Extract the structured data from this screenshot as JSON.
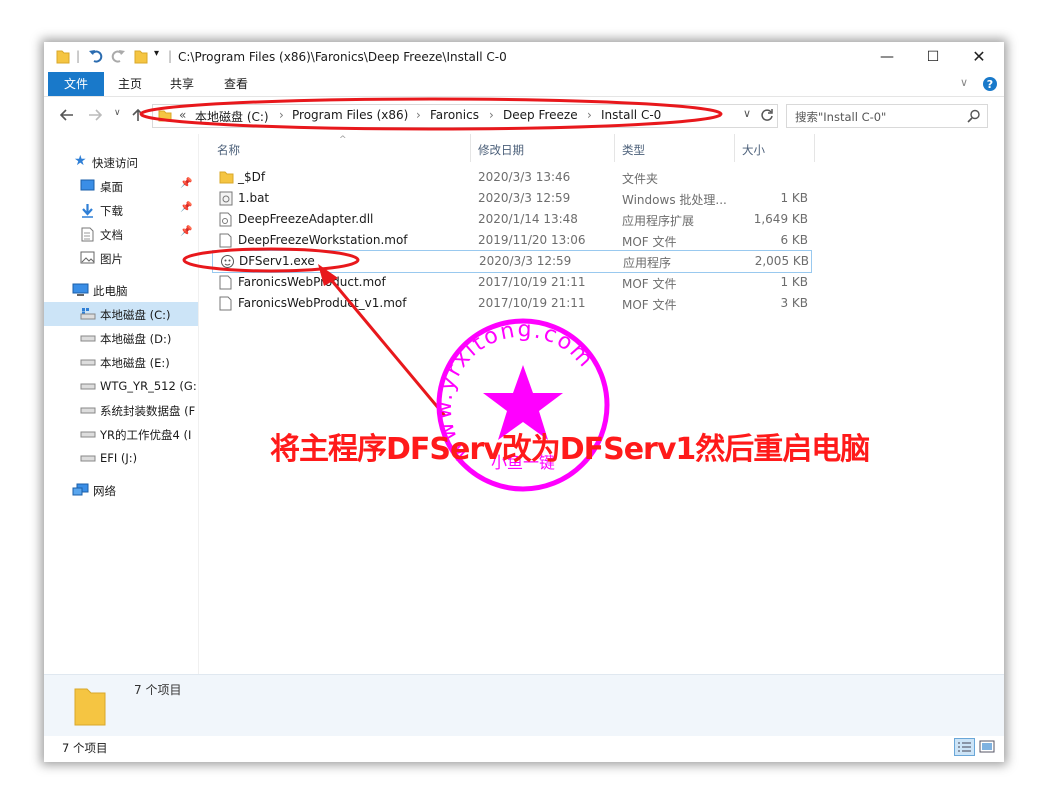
{
  "title_path": "C:\\Program Files (x86)\\Faronics\\Deep Freeze\\Install C-0",
  "ribbon_tabs": [
    "文件",
    "主页",
    "共享",
    "查看"
  ],
  "breadcrumb": {
    "overflow": "«",
    "parts": [
      "本地磁盘 (C:)",
      "Program Files (x86)",
      "Faronics",
      "Deep Freeze",
      "Install C-0"
    ]
  },
  "search": {
    "placeholder": "搜索\"Install C-0\""
  },
  "columns": [
    "名称",
    "修改日期",
    "类型",
    "大小"
  ],
  "nav": {
    "quick_access": "快速访问",
    "desktop": "桌面",
    "downloads": "下载",
    "documents": "文档",
    "pictures": "图片",
    "this_pc": "此电脑",
    "drive_c": "本地磁盘 (C:)",
    "drive_d": "本地磁盘 (D:)",
    "drive_e": "本地磁盘 (E:)",
    "drive_g": "WTG_YR_512 (G:",
    "drive_f": "系统封装数据盘 (F",
    "drive_i": "YR的工作优盘4 (I",
    "drive_j": "EFI (J:)",
    "network": "网络"
  },
  "files": [
    {
      "name": "_$Df",
      "date": "2020/3/3 13:46",
      "type": "文件夹",
      "size": "",
      "icon": "folder-icon"
    },
    {
      "name": "1.bat",
      "date": "2020/3/3 12:59",
      "type": "Windows 批处理...",
      "size": "1 KB",
      "icon": "batch-file-icon"
    },
    {
      "name": "DeepFreezeAdapter.dll",
      "date": "2020/1/14 13:48",
      "type": "应用程序扩展",
      "size": "1,649 KB",
      "icon": "dll-file-icon"
    },
    {
      "name": "DeepFreezeWorkstation.mof",
      "date": "2019/11/20 13:06",
      "type": "MOF 文件",
      "size": "6 KB",
      "icon": "file-icon"
    },
    {
      "name": "DFServ1.exe",
      "date": "2020/3/3 12:59",
      "type": "应用程序",
      "size": "2,005 KB",
      "icon": "exe-file-icon"
    },
    {
      "name": "FaronicsWebProduct.mof",
      "date": "2017/10/19 21:11",
      "type": "MOF 文件",
      "size": "1 KB",
      "icon": "file-icon"
    },
    {
      "name": "FaronicsWebProduct_v1.mof",
      "date": "2017/10/19 21:11",
      "type": "MOF 文件",
      "size": "3 KB",
      "icon": "file-icon"
    }
  ],
  "details_pane": {
    "count": "7 个项目"
  },
  "status_bar": {
    "count": "7 个项目"
  },
  "annotation": {
    "text": "将主程序DFServ改为DFServ1然后重启电脑"
  },
  "watermark": {
    "site": "www.yrxitong.com",
    "sub": "小鱼一键"
  },
  "colors": {
    "annotation_red": "#ff1a1a",
    "watermark_magenta": "#ff00ff",
    "ribbon_blue": "#1979ca",
    "selection": "#cce4f7"
  }
}
